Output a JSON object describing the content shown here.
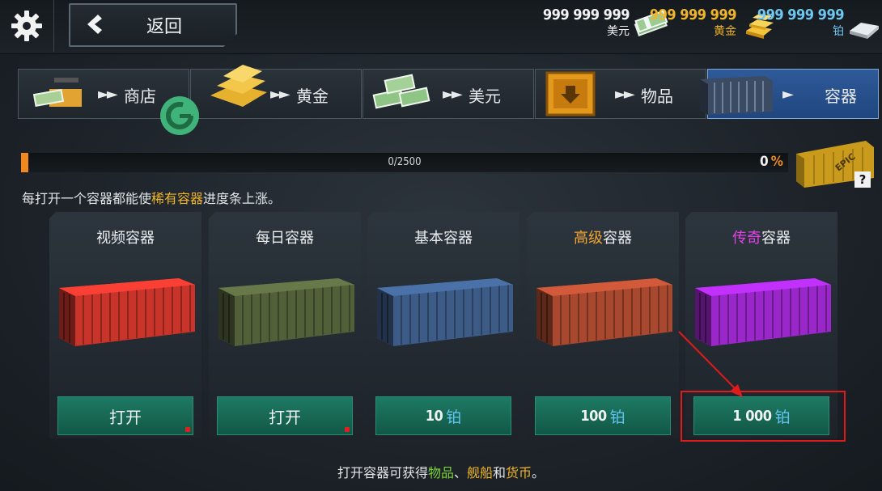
{
  "header": {
    "back_label": "返回",
    "currencies": {
      "usd": {
        "amount": "999 999 999",
        "name": "美元"
      },
      "gold": {
        "amount": "999 999 999",
        "name": "黄金"
      },
      "platinum": {
        "amount": "999 999 999",
        "name": "铂"
      }
    }
  },
  "tabs": [
    {
      "label": "商店",
      "icon": "shop-icon"
    },
    {
      "label": "黄金",
      "icon": "gold-bars-icon"
    },
    {
      "label": "美元",
      "icon": "dollar-stacks-icon"
    },
    {
      "label": "物品",
      "icon": "crate-icon"
    },
    {
      "label": "容器",
      "icon": "container-icon",
      "active": true
    }
  ],
  "progress": {
    "text": "0/2500",
    "percent_value": "0",
    "percent_sign": "%",
    "fraction": 0.01
  },
  "hint": {
    "before": "每打开一个容器都能使",
    "highlight": "稀有容器",
    "after": "进度条上涨。"
  },
  "cards": [
    {
      "title": "视频容器",
      "button": "打开",
      "container_color": "#c8332a"
    },
    {
      "title": "每日容器",
      "button": "打开",
      "container_color": "#52603a"
    },
    {
      "title": "基本容器",
      "price": "10",
      "currency": "铂",
      "container_color": "#3c5b86"
    },
    {
      "title_highlight": "高级",
      "title_rest": "容器",
      "price": "100",
      "currency": "铂",
      "container_color": "#a8482e"
    },
    {
      "title_highlight": "传奇",
      "title_rest": "容器",
      "price": "1 000",
      "currency": "铂",
      "container_color": "#9a27c9"
    }
  ],
  "footer": {
    "p1": "打开容器可获得",
    "items": "物品",
    "sep": "、",
    "ships": "舰船",
    "and": "和",
    "currency": "货币",
    "end": "。"
  },
  "colors": {
    "accent_orange": "#f08a1e",
    "gold": "#f0b52a",
    "platinum": "#6fc7f1",
    "button_green": "#1e7a63",
    "active_tab": "#2f5a99",
    "annotation_red": "#e01b1b"
  }
}
